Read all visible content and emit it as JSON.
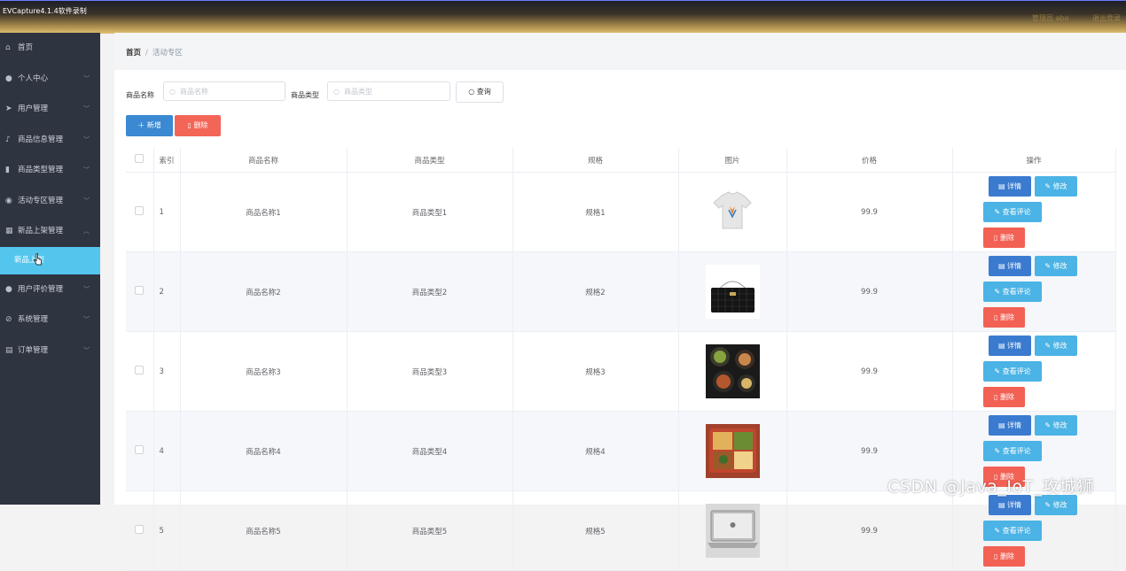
{
  "window": {
    "title": "EVCapture4.1.4软件录制"
  },
  "topbar": {
    "right_items": [
      "管理员 abo",
      "退出登录"
    ]
  },
  "sidebar": {
    "items": [
      {
        "label": "首页",
        "icon": "home-icon",
        "expandable": false
      },
      {
        "label": "个人中心",
        "icon": "user-icon",
        "expandable": true
      },
      {
        "label": "用户管理",
        "icon": "send-icon",
        "expandable": true
      },
      {
        "label": "商品信息管理",
        "icon": "mic-icon",
        "expandable": true
      },
      {
        "label": "商品类型管理",
        "icon": "trash-icon",
        "expandable": true
      },
      {
        "label": "活动专区管理",
        "icon": "location-icon",
        "expandable": true
      },
      {
        "label": "新品上架管理",
        "icon": "grid-icon",
        "expandable": true,
        "expanded": true
      }
    ],
    "active_sub": "新品上架",
    "items_after": [
      {
        "label": "用户评价管理",
        "icon": "user-icon",
        "expandable": true
      },
      {
        "label": "系统管理",
        "icon": "compass-icon",
        "expandable": true
      },
      {
        "label": "订单管理",
        "icon": "box-icon",
        "expandable": true
      }
    ]
  },
  "breadcrumb": {
    "home": "首页",
    "separator": "/",
    "current": "活动专区"
  },
  "search": {
    "name_label": "商品名称",
    "name_placeholder": "商品名称",
    "type_label": "商品类型",
    "type_placeholder": "商品类型",
    "query_label": "查询"
  },
  "actions": {
    "add_label": "新增",
    "delete_label": "删除"
  },
  "table": {
    "headers": [
      "索引",
      "商品名称",
      "商品类型",
      "规格",
      "图片",
      "价格",
      "操作"
    ],
    "op_labels": {
      "detail": "详情",
      "edit": "修改",
      "review": "查看评论",
      "remove": "删除"
    },
    "rows": [
      {
        "index": "1",
        "name": "商品名称1",
        "type": "商品类型1",
        "spec": "规格1",
        "image": "tshirt",
        "price": "99.9"
      },
      {
        "index": "2",
        "name": "商品名称2",
        "type": "商品类型2",
        "spec": "规格2",
        "image": "handbag",
        "price": "99.9"
      },
      {
        "index": "3",
        "name": "商品名称3",
        "type": "商品类型3",
        "spec": "规格3",
        "image": "food-bowls",
        "price": "99.9"
      },
      {
        "index": "4",
        "name": "商品名称4",
        "type": "商品类型4",
        "spec": "规格4",
        "image": "bento-box",
        "price": "99.9"
      },
      {
        "index": "5",
        "name": "商品名称5",
        "type": "商品类型5",
        "spec": "规格5",
        "image": "laptop",
        "price": "99.9"
      }
    ]
  },
  "watermark": "CSDN @Java_IoT_攻城狮",
  "colors": {
    "sidebar_bg": "#2f3441",
    "active_sub_bg": "#54c6ee",
    "primary": "#3a89d2",
    "danger": "#f36657",
    "info": "#4bb3e5"
  }
}
